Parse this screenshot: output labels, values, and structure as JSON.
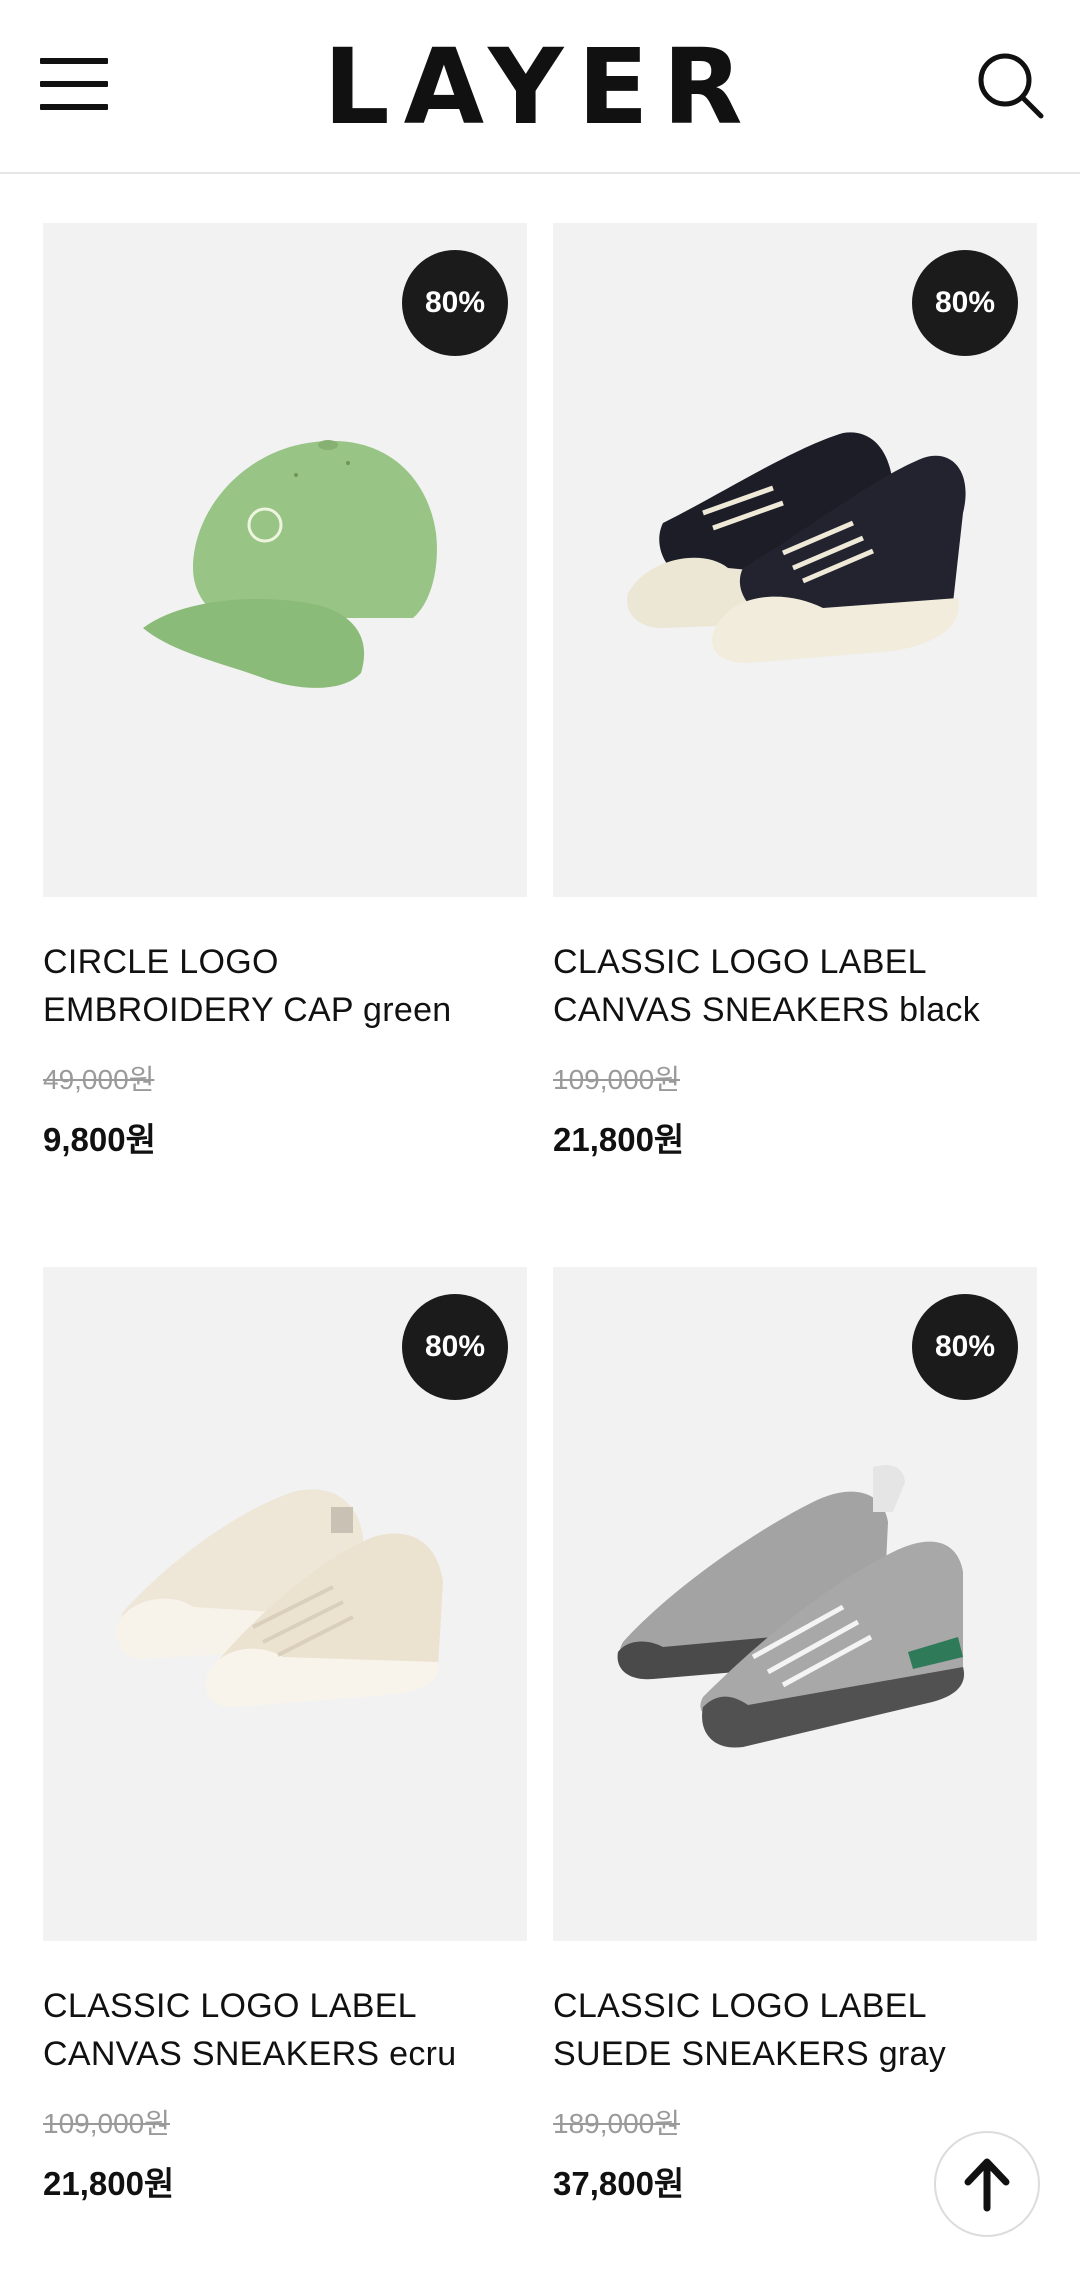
{
  "header": {
    "logo": "LAYER",
    "menu_icon": "hamburger-menu-icon",
    "search_icon": "search-icon"
  },
  "products": [
    {
      "discount": "80%",
      "name_line1": "CIRCLE LOGO",
      "name_line2": "EMBROIDERY CAP green",
      "original_price": "49,000원",
      "sale_price": "9,800원",
      "image": "green-cap-image"
    },
    {
      "discount": "80%",
      "name_line1": "CLASSIC LOGO LABEL",
      "name_line2": "CANVAS SNEAKERS black",
      "original_price": "109,000원",
      "sale_price": "21,800원",
      "image": "black-canvas-sneakers-image"
    },
    {
      "discount": "80%",
      "name_line1": "CLASSIC LOGO LABEL",
      "name_line2": "CANVAS SNEAKERS ecru",
      "original_price": "109,000원",
      "sale_price": "21,800원",
      "image": "ecru-canvas-sneakers-image"
    },
    {
      "discount": "80%",
      "name_line1": "CLASSIC LOGO LABEL",
      "name_line2": "SUEDE SNEAKERS gray",
      "original_price": "189,000원",
      "sale_price": "37,800원",
      "image": "gray-suede-sneakers-image"
    }
  ],
  "scroll_top_icon": "arrow-up-icon",
  "colors": {
    "badge_bg": "#1b1b1b",
    "thumb_bg": "#f2f2f2",
    "strike_price": "#9a9a9a"
  }
}
